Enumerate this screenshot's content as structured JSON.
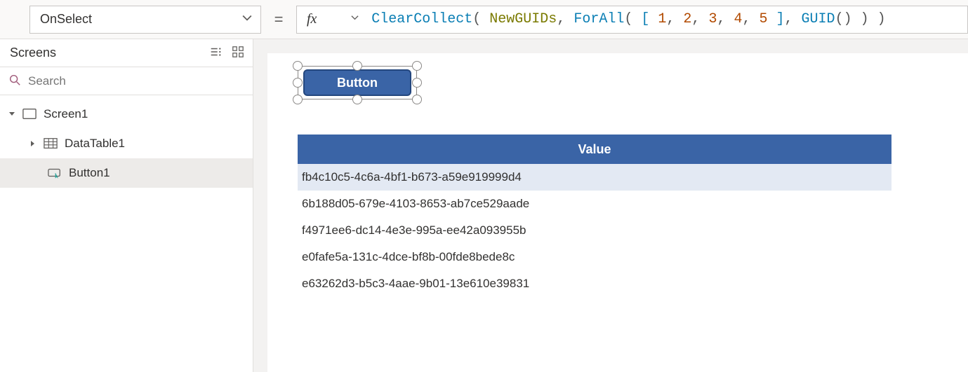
{
  "formula": {
    "property": "OnSelect",
    "tokens": {
      "t0": "ClearCollect",
      "t1": "( ",
      "t2": "NewGUIDs",
      "t3": ", ",
      "t4": "ForAll",
      "t5": "( ",
      "t6": "[ ",
      "t7a": "1",
      "t7s": ", ",
      "t7b": "2",
      "t7c": "3",
      "t7d": "4",
      "t7e": "5",
      "t8": " ]",
      "t9": ", ",
      "t10": "GUID",
      "t11": "() ) )"
    }
  },
  "panel": {
    "title": "Screens",
    "search_placeholder": "Search"
  },
  "tree": {
    "screen1": "Screen1",
    "datatable1": "DataTable1",
    "button1": "Button1"
  },
  "canvas": {
    "button_label": "Button",
    "table_header": "Value",
    "rows": {
      "r0": "fb4c10c5-4c6a-4bf1-b673-a59e919999d4",
      "r1": "6b188d05-679e-4103-8653-ab7ce529aade",
      "r2": "f4971ee6-dc14-4e3e-995a-ee42a093955b",
      "r3": "e0fafe5a-131c-4dce-bf8b-00fde8bede8c",
      "r4": "e63262d3-b5c3-4aae-9b01-13e610e39831"
    }
  }
}
